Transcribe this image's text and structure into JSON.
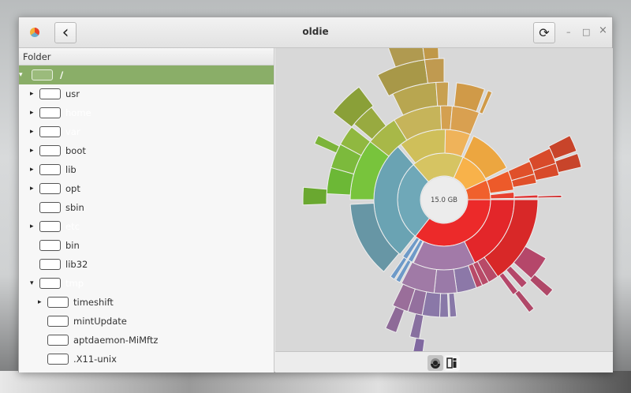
{
  "window": {
    "title": "oldie",
    "back_icon": "‹",
    "refresh_icon": "⟳",
    "minimize": "–",
    "maximize": "□",
    "close": "×"
  },
  "tree": {
    "column_header": "Folder",
    "rows": [
      {
        "label": "/",
        "level": 0,
        "expander": "open",
        "selected": true
      },
      {
        "label": "usr",
        "level": 1,
        "expander": "closed"
      },
      {
        "label": "home",
        "level": 1,
        "expander": "closed",
        "faded": true
      },
      {
        "label": "var",
        "level": 1,
        "expander": "closed",
        "faded": true
      },
      {
        "label": "boot",
        "level": 1,
        "expander": "closed"
      },
      {
        "label": "lib",
        "level": 1,
        "expander": "closed"
      },
      {
        "label": "opt",
        "level": 1,
        "expander": "closed"
      },
      {
        "label": "sbin",
        "level": 1,
        "expander": "none"
      },
      {
        "label": "etc",
        "level": 1,
        "expander": "closed",
        "faded": true
      },
      {
        "label": "bin",
        "level": 1,
        "expander": "none"
      },
      {
        "label": "lib32",
        "level": 1,
        "expander": "none"
      },
      {
        "label": "tmp",
        "level": 1,
        "expander": "open",
        "faded": true
      },
      {
        "label": "timeshift",
        "level": 2,
        "expander": "closed"
      },
      {
        "label": "mintUpdate",
        "level": 2,
        "expander": "none"
      },
      {
        "label": "aptdaemon-MiMftz",
        "level": 2,
        "expander": "none"
      },
      {
        "label": ".X11-unix",
        "level": 2,
        "expander": "none"
      }
    ]
  },
  "view_toggle": {
    "rings_icon": "rings-chart-icon",
    "treemap_icon": "treemap-icon",
    "active": "rings"
  },
  "chart_data": {
    "type": "sunburst",
    "center_label": "15.0 GB",
    "segments_pct": [
      [
        1,
        0,
        35.6,
        "#ec2a2a"
      ],
      [
        1,
        35.6,
        63.6,
        "#6fa8b8"
      ],
      [
        1,
        63.6,
        81.7,
        "#d6c462"
      ],
      [
        1,
        81.7,
        93.1,
        "#f8b24a"
      ],
      [
        1,
        93.1,
        100,
        "#f0602c"
      ],
      [
        2,
        0,
        17.8,
        "#e3262a"
      ],
      [
        2,
        17.8,
        32.2,
        "#a27aa8"
      ],
      [
        2,
        32.5,
        33.6,
        "#6e9ac8"
      ],
      [
        2,
        33.9,
        35,
        "#6e9ac8"
      ],
      [
        2,
        35.8,
        63.6,
        "#6aa3b3"
      ],
      [
        2,
        64.4,
        75.3,
        "#cfbf5a"
      ],
      [
        2,
        75.3,
        81.1,
        "#efb35a"
      ],
      [
        2,
        81.9,
        92.5,
        "#eca640"
      ],
      [
        2,
        93.3,
        97.8,
        "#ed5a2a"
      ],
      [
        2,
        98.3,
        99.7,
        "#e84030"
      ],
      [
        3,
        0,
        15.3,
        "#d82828"
      ],
      [
        3,
        15.3,
        17.1,
        "#b84a68"
      ],
      [
        3,
        17.1,
        18.3,
        "#b84a68"
      ],
      [
        3,
        18.3,
        19.4,
        "#b84a68"
      ],
      [
        3,
        19.4,
        22.8,
        "#8c78a8"
      ],
      [
        3,
        22.8,
        26.7,
        "#9a7aa8"
      ],
      [
        3,
        26.7,
        32.5,
        "#a07aa6"
      ],
      [
        3,
        32.8,
        33.6,
        "#6e9ac8"
      ],
      [
        3,
        33.9,
        34.7,
        "#6e9ac8"
      ],
      [
        3,
        36.1,
        49.2,
        "#6796a5"
      ],
      [
        3,
        50,
        60.6,
        "#78c43c"
      ],
      [
        3,
        60.6,
        66.1,
        "#a8b848"
      ],
      [
        3,
        66.1,
        74.4,
        "#c6b45a"
      ],
      [
        3,
        74.4,
        76.4,
        "#d4a050"
      ],
      [
        3,
        76.4,
        81.1,
        "#d9a050"
      ],
      [
        3,
        93.3,
        95.6,
        "#e0502a"
      ],
      [
        3,
        95.6,
        97.2,
        "#e0502a"
      ],
      [
        3,
        99.2,
        99.7,
        "#e03030"
      ],
      [
        4,
        8.3,
        11.7,
        "#b5476a"
      ],
      [
        4,
        12.5,
        13.5,
        "#b5476a"
      ],
      [
        4,
        14.2,
        15,
        "#b5476a"
      ],
      [
        4,
        23.3,
        24.2,
        "#8878a8"
      ],
      [
        4,
        24.4,
        25.6,
        "#8878a8"
      ],
      [
        4,
        25.6,
        28,
        "#8a78a8"
      ],
      [
        4,
        28,
        30,
        "#94709e"
      ],
      [
        4,
        30,
        32.2,
        "#9a6e9a"
      ],
      [
        4,
        50.8,
        54.4,
        "#6cb836"
      ],
      [
        4,
        54.4,
        57.8,
        "#7cba3c"
      ],
      [
        4,
        57.8,
        60.6,
        "#90b840"
      ],
      [
        4,
        61.1,
        64.4,
        "#98aa40"
      ],
      [
        4,
        67.8,
        73.9,
        "#b8a650"
      ],
      [
        4,
        73.9,
        75.6,
        "#c8a050"
      ],
      [
        4,
        76.7,
        80.6,
        "#d09a48"
      ],
      [
        4,
        81.1,
        81.7,
        "#d09a48"
      ],
      [
        4,
        92.8,
        95,
        "#d84a2a"
      ],
      [
        4,
        95,
        96.7,
        "#d84a2a"
      ],
      [
        4,
        99.4,
        99.7,
        "#d02828"
      ],
      [
        5,
        49.4,
        51.4,
        "#6aa830"
      ],
      [
        5,
        56.5,
        57.5,
        "#7cb43a"
      ],
      [
        5,
        60.6,
        64.7,
        "#8aa038"
      ],
      [
        5,
        67.2,
        72.8,
        "#a89848"
      ],
      [
        5,
        72.8,
        75,
        "#c09a50"
      ],
      [
        5,
        92.5,
        94.4,
        "#c8442a"
      ],
      [
        5,
        94.7,
        96.3,
        "#c8442a"
      ],
      [
        5,
        27.8,
        28.9,
        "#8870a0"
      ],
      [
        5,
        30.5,
        31.8,
        "#8e6a98"
      ],
      [
        5,
        14,
        14.7,
        "#b04868"
      ],
      [
        5,
        11,
        12,
        "#b04868"
      ],
      [
        6,
        69.4,
        72.8,
        "#b09a50"
      ],
      [
        6,
        72.8,
        74.4,
        "#c09848"
      ],
      [
        6,
        27.2,
        28.2,
        "#8068a0"
      ]
    ]
  }
}
